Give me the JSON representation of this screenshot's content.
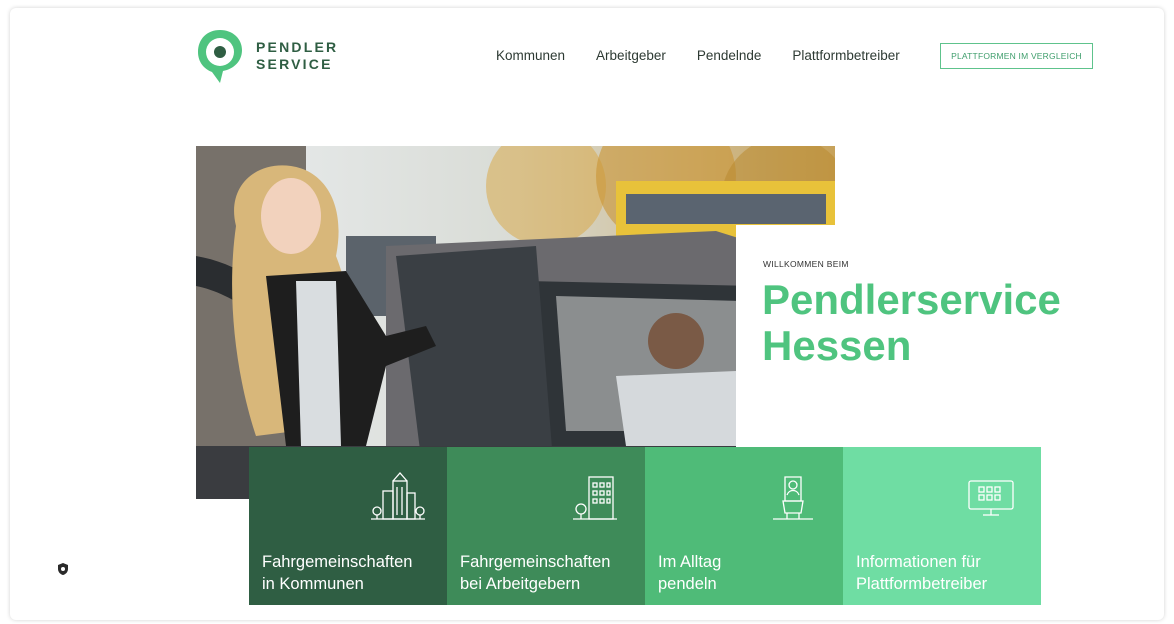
{
  "brand": {
    "line1": "PENDLER",
    "line2": "SERVICE",
    "logo_icon": "location-pin-icon",
    "color": "#4fc47f"
  },
  "nav": {
    "items": [
      "Kommunen",
      "Arbeitgeber",
      "Pendelnde",
      "Plattformbetreiber"
    ]
  },
  "cta": {
    "label": "PLATTFORMEN IM VERGLEICH"
  },
  "hero": {
    "kicker": "WILLKOMMEN BEIM",
    "title_line1": "Pendlerservice",
    "title_line2": "Hessen"
  },
  "tiles": [
    {
      "line1": "Fahrgemeinschaften",
      "line2": "in Kommunen",
      "icon": "city-buildings-icon",
      "color": "#2f5e43"
    },
    {
      "line1": "Fahrgemeinschaften",
      "line2": "bei Arbeitgebern",
      "icon": "office-building-icon",
      "color": "#3e8b59"
    },
    {
      "line1": "Im Alltag",
      "line2": "pendeln",
      "icon": "commuter-seat-icon",
      "color": "#4fbb78"
    },
    {
      "line1": "Informationen für",
      "line2": "Plattformbetreiber",
      "icon": "monitor-icon",
      "color": "#6fdda3"
    }
  ],
  "floating": {
    "icon": "shield-icon"
  }
}
